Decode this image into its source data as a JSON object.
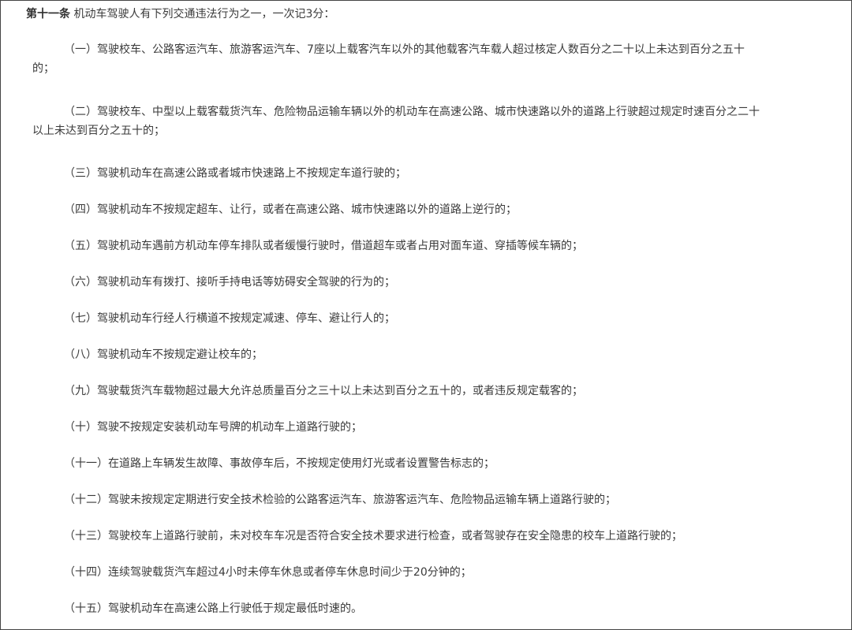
{
  "article": {
    "number": "第十一条",
    "lead": "机动车驾驶人有下列交通违法行为之一，一次记3分："
  },
  "items": [
    {
      "num": "（一）",
      "text": "驾驶校车、公路客运汽车、旅游客运汽车、7座以上载客汽车以外的其他载客汽车载人超过核定人数百分之二十以上未达到百分之五十",
      "cont": "的；"
    },
    {
      "num": "（二）",
      "text": "驾驶校车、中型以上载客载货汽车、危险物品运输车辆以外的机动车在高速公路、城市快速路以外的道路上行驶超过规定时速百分之二十",
      "cont": "以上未达到百分之五十的；"
    },
    {
      "num": "（三）",
      "text": "驾驶机动车在高速公路或者城市快速路上不按规定车道行驶的；"
    },
    {
      "num": "（四）",
      "text": "驾驶机动车不按规定超车、让行，或者在高速公路、城市快速路以外的道路上逆行的；"
    },
    {
      "num": "（五）",
      "text": "驾驶机动车遇前方机动车停车排队或者缓慢行驶时，借道超车或者占用对面车道、穿插等候车辆的；"
    },
    {
      "num": "（六）",
      "text": "驾驶机动车有拨打、接听手持电话等妨碍安全驾驶的行为的；"
    },
    {
      "num": "（七）",
      "text": "驾驶机动车行经人行横道不按规定减速、停车、避让行人的；"
    },
    {
      "num": "（八）",
      "text": "驾驶机动车不按规定避让校车的；"
    },
    {
      "num": "（九）",
      "text": "驾驶载货汽车载物超过最大允许总质量百分之三十以上未达到百分之五十的，或者违反规定载客的；"
    },
    {
      "num": "（十）",
      "text": "驾驶不按规定安装机动车号牌的机动车上道路行驶的；"
    },
    {
      "num": "（十一）",
      "text": "在道路上车辆发生故障、事故停车后，不按规定使用灯光或者设置警告标志的；"
    },
    {
      "num": "（十二）",
      "text": "驾驶未按规定定期进行安全技术检验的公路客运汽车、旅游客运汽车、危险物品运输车辆上道路行驶的；"
    },
    {
      "num": "（十三）",
      "text": "驾驶校车上道路行驶前，未对校车车况是否符合安全技术要求进行检查，或者驾驶存在安全隐患的校车上道路行驶的；"
    },
    {
      "num": "（十四）",
      "text": "连续驾驶载货汽车超过4小时未停车休息或者停车休息时间少于20分钟的；"
    },
    {
      "num": "（十五）",
      "text": "驾驶机动车在高速公路上行驶低于规定最低时速的。"
    }
  ]
}
